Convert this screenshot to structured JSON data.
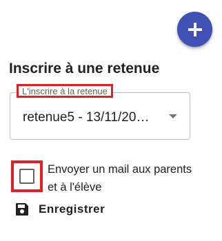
{
  "fab": {
    "icon": "plus-icon",
    "color": "#3f51b5"
  },
  "title": "Inscrire à une retenue",
  "select": {
    "label": "L'inscrire à la retenue",
    "value": "retenue5 - 13/11/20…",
    "icon": "arrow-drop-down-icon"
  },
  "checkbox": {
    "label_line1": "Envoyer un mail aux parents",
    "label_line2": "et à l'élève",
    "checked": false
  },
  "save": {
    "label": "Enregistrer",
    "icon": "save-icon"
  },
  "colors": {
    "accent": "#3f51b5",
    "highlight": "#e31e24"
  }
}
